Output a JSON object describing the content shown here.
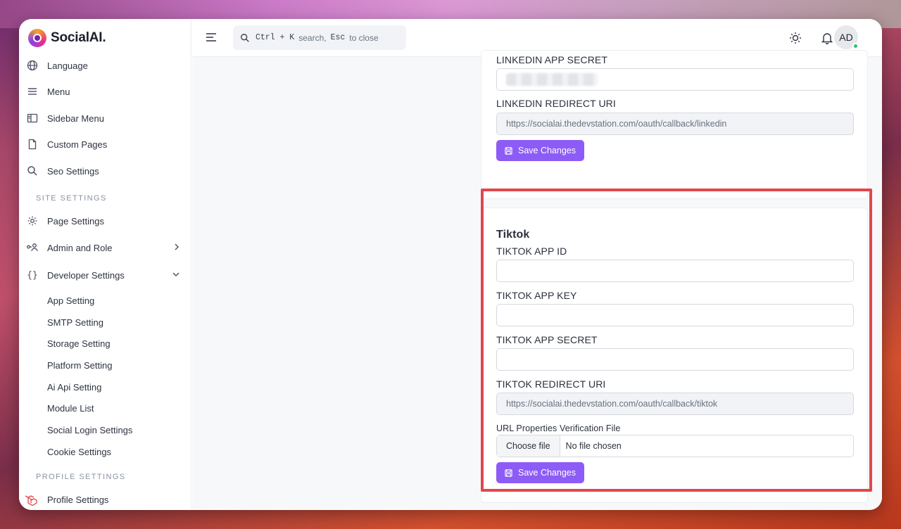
{
  "brand": {
    "name": "SocialAI."
  },
  "sidebar": {
    "items": [
      {
        "label": "Language",
        "icon": "globe-icon"
      },
      {
        "label": "Menu",
        "icon": "menu-icon"
      },
      {
        "label": "Sidebar Menu",
        "icon": "sidebar-layout-icon"
      },
      {
        "label": "Custom Pages",
        "icon": "document-icon"
      },
      {
        "label": "Seo Settings",
        "icon": "search-icon"
      }
    ],
    "site_settings_label": "SITE SETTINGS",
    "site_items": [
      {
        "label": "Page Settings",
        "icon": "gear-icon"
      },
      {
        "label": "Admin and Role",
        "icon": "user-key-icon"
      },
      {
        "label": "Developer Settings",
        "icon": "braces-icon"
      }
    ],
    "dev_sub_items": [
      "App Setting",
      "SMTP Setting",
      "Storage Setting",
      "Platform Setting",
      "Ai Api Setting",
      "Module List",
      "Social Login Settings",
      "Cookie Settings"
    ],
    "profile_settings_label": "PROFILE SETTINGS",
    "profile_item": "Profile Settings"
  },
  "topbar": {
    "search": {
      "shortcut1": "Ctrl + K",
      "text1": "search,",
      "shortcut2": "Esc",
      "text2": "to close"
    },
    "avatar_initials": "AD"
  },
  "linkedin": {
    "secret_label": "LINKEDIN APP SECRET",
    "redirect_label": "LINKEDIN REDIRECT URI",
    "redirect_value": "https://socialai.thedevstation.com/oauth/callback/linkedin",
    "save_label": "Save Changes"
  },
  "tiktok": {
    "title": "Tiktok",
    "app_id_label": "TIKTOK APP ID",
    "app_id_value": "",
    "app_key_label": "TIKTOK APP KEY",
    "app_key_value": "",
    "app_secret_label": "TIKTOK APP SECRET",
    "app_secret_value": "",
    "redirect_label": "TIKTOK REDIRECT URI",
    "redirect_value": "https://socialai.thedevstation.com/oauth/callback/tiktok",
    "verification_label": "URL Properties Verification File",
    "choose_file": "Choose file",
    "no_file": "No file chosen",
    "save_label": "Save Changes"
  },
  "colors": {
    "accent": "#8d5cf6",
    "highlight": "#e0474c",
    "online": "#2fbf71"
  }
}
